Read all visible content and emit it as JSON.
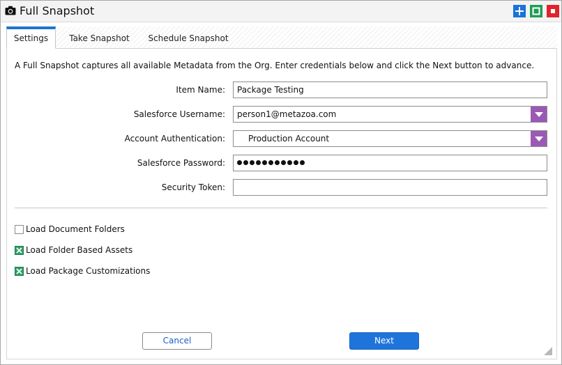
{
  "window": {
    "title": "Full Snapshot",
    "icon": "camera-icon",
    "controls": [
      "add-icon",
      "maximize-icon",
      "close-icon"
    ],
    "colors": {
      "add": "#1a73d8",
      "maximize": "#1f9d52",
      "close": "#e1242b"
    }
  },
  "tabs": [
    {
      "label": "Settings",
      "active": true
    },
    {
      "label": "Take Snapshot",
      "active": false
    },
    {
      "label": "Schedule Snapshot",
      "active": false
    }
  ],
  "intro": "A Full Snapshot captures all available Metadata from the Org. Enter credentials below and click the Next button to advance.",
  "form": {
    "item_name": {
      "label": "Item Name:",
      "value": "Package Testing"
    },
    "username": {
      "label": "Salesforce Username:",
      "value": "person1@metazoa.com"
    },
    "auth": {
      "label": "Account Authentication:",
      "value": "Production Account"
    },
    "password": {
      "label": "Salesforce Password:",
      "masked_length": 11
    },
    "token": {
      "label": "Security Token:",
      "value": ""
    }
  },
  "options": [
    {
      "label": "Load Document Folders",
      "checked": false
    },
    {
      "label": "Load Folder Based Assets",
      "checked": true
    },
    {
      "label": "Load Package Customizations",
      "checked": true
    }
  ],
  "buttons": {
    "cancel": "Cancel",
    "next": "Next"
  },
  "accent_colors": {
    "tab_active": "#1e73d2",
    "dropdown": "#9b59b6",
    "next_button": "#1f74dc",
    "checkbox_checked": "#2e9e64"
  }
}
